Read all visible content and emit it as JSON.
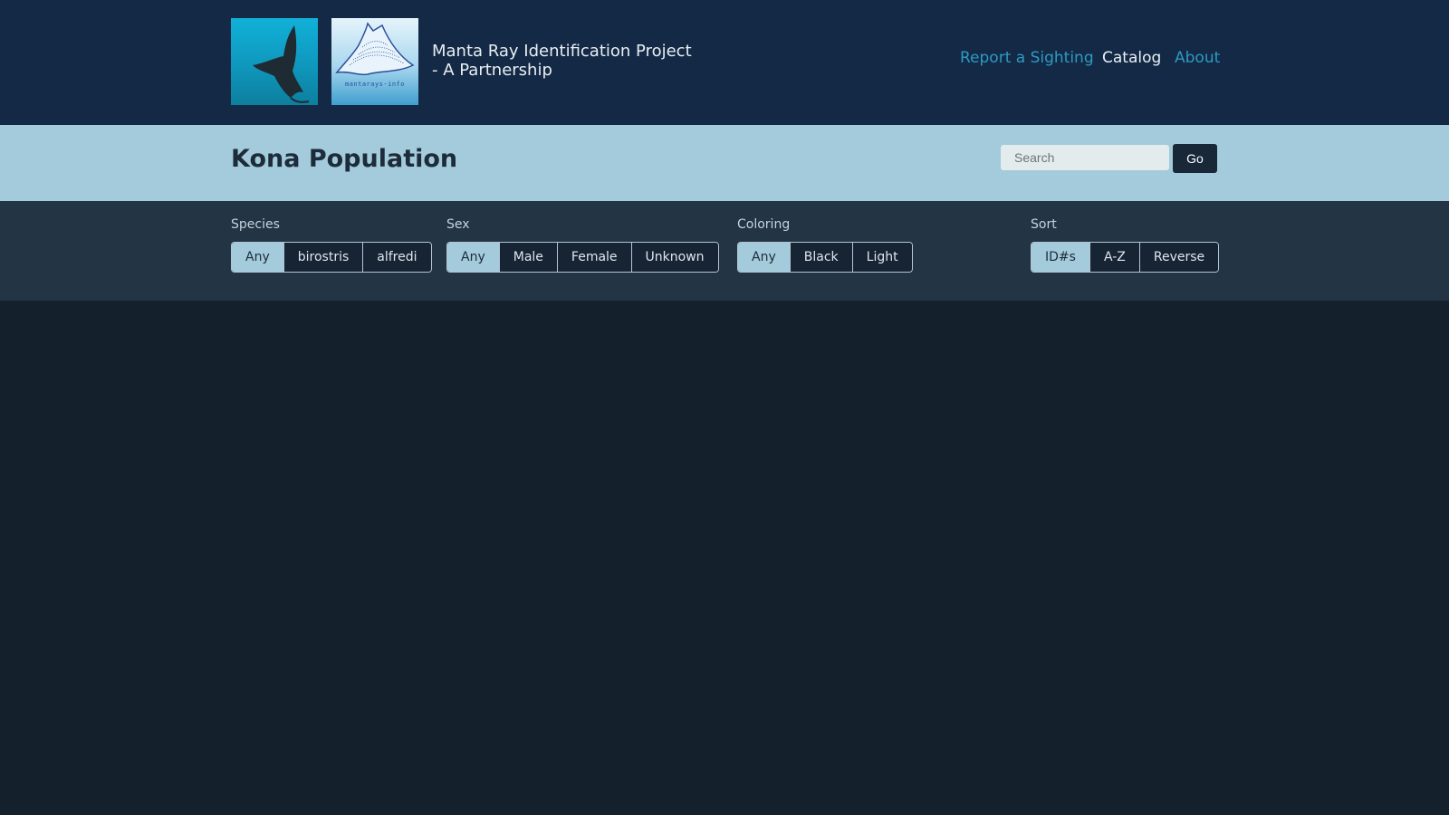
{
  "header": {
    "logo_left_icon": "manta-ray-silhouette-icon",
    "logo_right_text": "mantarays-info",
    "title_line1": "Manta Ray Identification Project",
    "title_line2": "- A Partnership",
    "nav": {
      "report": "Report a Sighting",
      "catalog": "Catalog",
      "about": "About"
    }
  },
  "page": {
    "title": "Kona Population",
    "search_placeholder": "Search",
    "go_label": "Go"
  },
  "filters": {
    "species": {
      "label": "Species",
      "options": [
        "Any",
        "birostris",
        "alfredi"
      ],
      "selected": "Any"
    },
    "sex": {
      "label": "Sex",
      "options": [
        "Any",
        "Male",
        "Female",
        "Unknown"
      ],
      "selected": "Any"
    },
    "coloring": {
      "label": "Coloring",
      "options": [
        "Any",
        "Black",
        "Light"
      ],
      "selected": "Any"
    },
    "sort": {
      "label": "Sort",
      "options": [
        "ID#s",
        "A-Z",
        "Reverse"
      ],
      "selected": "ID#s"
    }
  },
  "colors": {
    "header_bg": "#132945",
    "band_bg": "#a3cbdb",
    "filters_bg": "#233445",
    "body_bg": "#14202c",
    "link_accent": "#2d9ac2"
  }
}
